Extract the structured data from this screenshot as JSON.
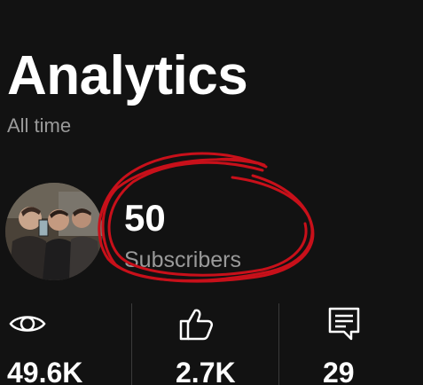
{
  "header": {
    "back_icon": "chevron-left-icon",
    "title": "Analytics",
    "period": "All time"
  },
  "channel": {
    "avatar": "channel-avatar-photo",
    "subscribers_count": "50",
    "subscribers_label": "Subscribers"
  },
  "annotation": {
    "type": "hand-drawn circle",
    "color": "#c8101a"
  },
  "stats": [
    {
      "icon": "eye-icon",
      "value": "49.6K"
    },
    {
      "icon": "thumbs-up-icon",
      "value": "2.7K"
    },
    {
      "icon": "comment-icon",
      "value": "29"
    }
  ]
}
